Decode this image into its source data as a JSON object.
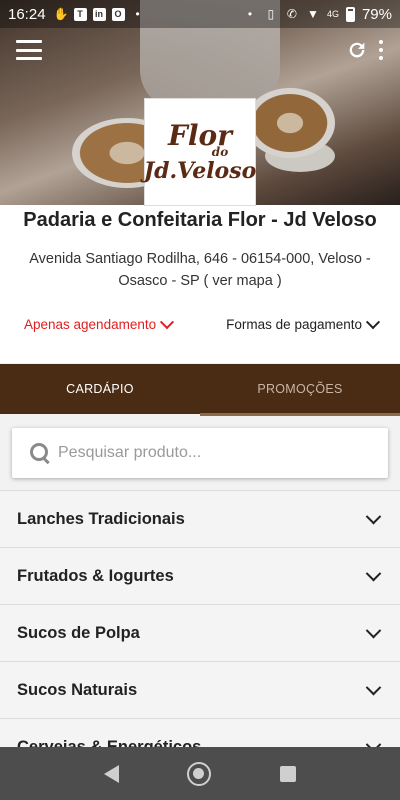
{
  "status_bar": {
    "time": "16:24",
    "battery": "79%",
    "icons": [
      "hand-icon",
      "t-icon",
      "linkedin-icon",
      "outlook-icon",
      "dot-icon",
      "vibrate-icon",
      "wifi-call-icon",
      "wifi-icon",
      "4g-signal-icon",
      "battery-icon"
    ],
    "net_label": "4G"
  },
  "header": {
    "menu_icon": "hamburger-icon",
    "refresh_icon": "refresh-icon",
    "more_icon": "more-vert-icon"
  },
  "logo": {
    "line1": "Flor",
    "line2": "do",
    "line3": "Jd.Veloso"
  },
  "store": {
    "name": "Padaria e Confeitaria Flor - Jd Veloso",
    "address": "Avenida Santiago Rodilha, 646 - 06154-000, Veloso - Osasco - SP",
    "map_link": "( ver mapa )",
    "scheduling": "Apenas agendamento",
    "payment": "Formas de pagamento"
  },
  "tabs": [
    {
      "label": "CARDÁPIO",
      "active": true
    },
    {
      "label": "PROMOÇÕES",
      "active": false
    }
  ],
  "search": {
    "placeholder": "Pesquisar produto..."
  },
  "categories": [
    {
      "label": "Lanches Tradicionais"
    },
    {
      "label": "Frutados & Iogurtes"
    },
    {
      "label": "Sucos de Polpa"
    },
    {
      "label": "Sucos Naturais"
    },
    {
      "label": "Cervejas & Energéticos"
    }
  ],
  "colors": {
    "brand_brown": "#4a2b14",
    "accent_red": "#e02020"
  }
}
